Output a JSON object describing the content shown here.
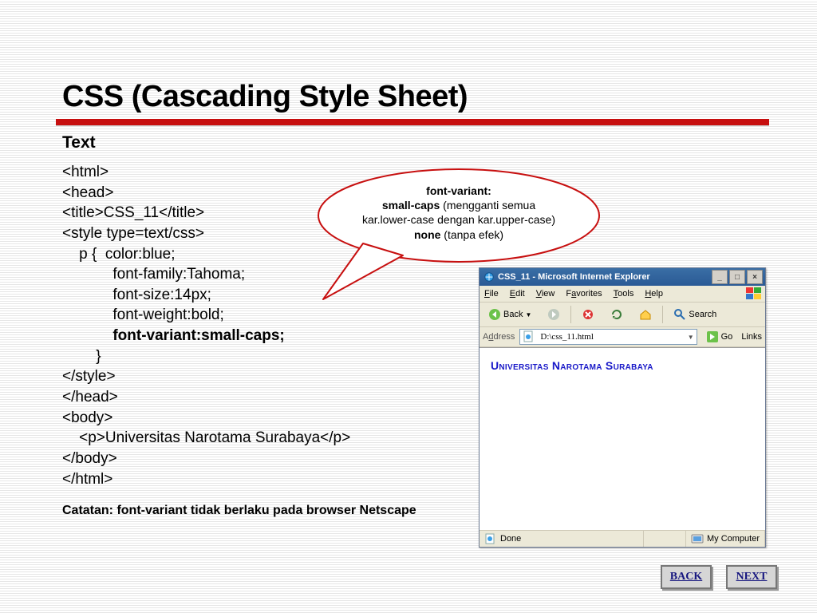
{
  "title": "CSS (Cascading Style Sheet)",
  "subhead": "Text",
  "code_lines": [
    {
      "indent": 0,
      "text": "<html>"
    },
    {
      "indent": 0,
      "text": "<head>"
    },
    {
      "indent": 0,
      "text": "<title>CSS_11</title>"
    },
    {
      "indent": 0,
      "text": "<style type=text/css>"
    },
    {
      "indent": 1,
      "text": "p {  color:blue;"
    },
    {
      "indent": 3,
      "text": "font-family:Tahoma;"
    },
    {
      "indent": 3,
      "text": "font-size:14px;"
    },
    {
      "indent": 3,
      "text": "font-weight:bold;"
    },
    {
      "indent": 3,
      "text": "font-variant:small-caps;",
      "bold": true
    },
    {
      "indent": 2,
      "text": "}"
    },
    {
      "indent": 0,
      "text": "</style>"
    },
    {
      "indent": 0,
      "text": "</head>"
    },
    {
      "indent": 0,
      "text": "<body>"
    },
    {
      "indent": 1,
      "text": "<p>Universitas Narotama Surabaya</p>"
    },
    {
      "indent": 0,
      "text": "</body>"
    },
    {
      "indent": 0,
      "text": "</html>"
    }
  ],
  "bubble": {
    "l1b": "font-variant:",
    "l2b": "small-caps",
    "l2r": " (mengganti semua",
    "l3": "kar.lower-case dengan kar.upper-case)",
    "l4b": "none",
    "l4r": " (tanpa efek)"
  },
  "note": "Catatan: font-variant tidak berlaku pada browser Netscape",
  "ie": {
    "title": "CSS_11 - Microsoft Internet Explorer",
    "menu": {
      "file": "File",
      "edit": "Edit",
      "view": "View",
      "fav": "Favorites",
      "tools": "Tools",
      "help": "Help"
    },
    "toolbar": {
      "back": "Back",
      "search": "Search"
    },
    "address_label": "Address",
    "address_value": "D:\\css_11.html",
    "go": "Go",
    "links": "Links",
    "page_text": "Universitas Narotama Surabaya",
    "status_done": "Done",
    "status_zone": "My Computer"
  },
  "nav": {
    "back": "BACK",
    "next": "NEXT"
  }
}
